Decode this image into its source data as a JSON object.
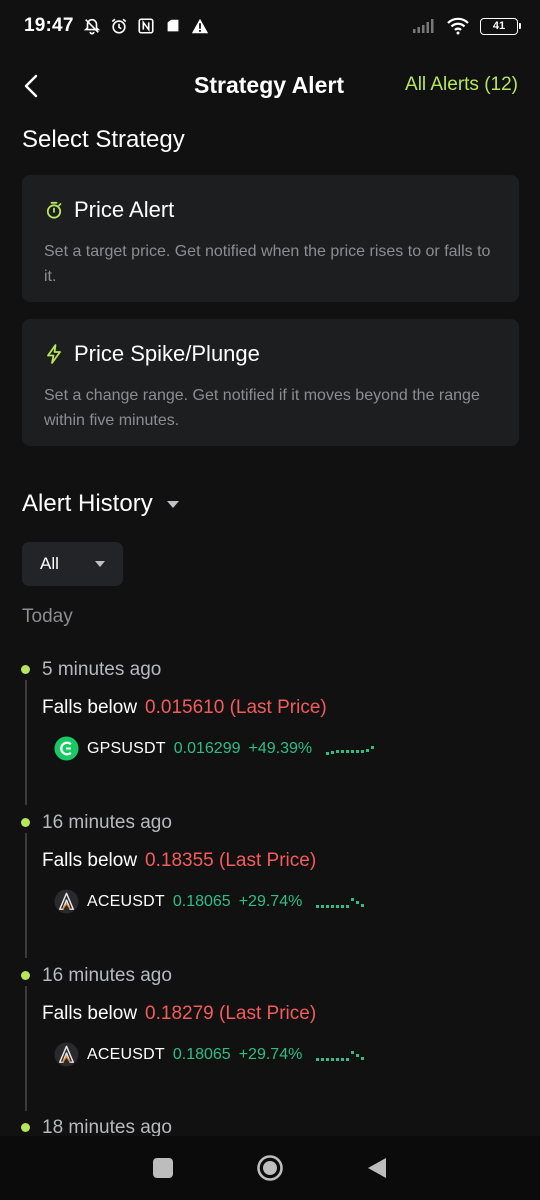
{
  "status_bar": {
    "time": "19:47",
    "battery": "41",
    "icons": [
      "bell-off-icon",
      "alarm-icon",
      "nfc-icon",
      "sim-icon",
      "warning-icon",
      "signal-icon",
      "wifi-icon",
      "battery-icon"
    ]
  },
  "header": {
    "title": "Strategy Alert",
    "all_alerts": "All Alerts (12)"
  },
  "select_strategy": {
    "title": "Select Strategy",
    "cards": [
      {
        "icon": "stopwatch-icon",
        "title": "Price Alert",
        "desc": "Set a target price. Get notified when the price rises to or falls to it."
      },
      {
        "icon": "lightning-icon",
        "title": "Price Spike/Plunge",
        "desc": "Set a change range. Get notified if it moves beyond the range within five minutes."
      }
    ]
  },
  "history": {
    "title": "Alert History",
    "filter": "All",
    "group_label": "Today",
    "entries": [
      {
        "time": "5 minutes ago",
        "condition": "Falls below",
        "target": "0.015610 (Last Price)",
        "symbol": "GPSUSDT",
        "price": "0.016299",
        "change": "+49.39%",
        "logo": "gps-logo"
      },
      {
        "time": "16 minutes ago",
        "condition": "Falls below",
        "target": "0.18355 (Last Price)",
        "symbol": "ACEUSDT",
        "price": "0.18065",
        "change": "+29.74%",
        "logo": "ace-logo"
      },
      {
        "time": "16 minutes ago",
        "condition": "Falls below",
        "target": "0.18279 (Last Price)",
        "symbol": "ACEUSDT",
        "price": "0.18065",
        "change": "+29.74%",
        "logo": "ace-logo"
      },
      {
        "time": "18 minutes ago"
      }
    ]
  },
  "colors": {
    "accent": "#b7e55c",
    "down": "#f45b5b",
    "up": "#2ebd85",
    "card_bg": "#1d1e20",
    "bg": "#111112"
  }
}
